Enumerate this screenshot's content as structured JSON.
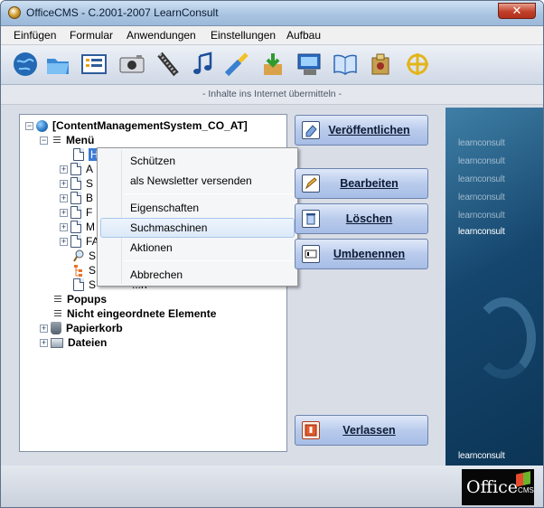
{
  "window": {
    "title": "OfficeCMS - C.2001-2007 LearnConsult",
    "close_label": "✕"
  },
  "menubar": [
    "Einfügen",
    "Formular",
    "Anwendungen",
    "Einstellungen",
    "Aufbau"
  ],
  "toolbar": {
    "icons": [
      "globe-icon",
      "folder-icon",
      "form-list-icon",
      "camera-icon",
      "film-icon",
      "music-note-icon",
      "brush-icon",
      "download-box-icon",
      "projector-icon",
      "book-icon",
      "puzzle-icon",
      "target-icon"
    ]
  },
  "status_text": "- Inhalte ins Internet übermitteln -",
  "tree": {
    "root": "[ContentManagementSystem_CO_AT]",
    "menu": "Menü",
    "children_hidden": [
      "H",
      "A",
      "S",
      "B",
      "F",
      "M",
      "FA",
      "S",
      "S",
      "S"
    ],
    "popups": "Popups",
    "unassigned": "Nicht eingeordnete Elemente",
    "trash": "Papierkorb",
    "files": "Dateien",
    "partial_suffix": "...n"
  },
  "context_menu": {
    "items": [
      "Schützen",
      "als Newsletter versenden",
      "Eigenschaften",
      "Suchmaschinen",
      "Aktionen",
      "Abbrechen"
    ]
  },
  "buttons": {
    "publish": "Veröffentlichen",
    "edit": "Bearbeiten",
    "delete": "Löschen",
    "rename": "Umbenennen",
    "exit": "Verlassen"
  },
  "brand": {
    "logo_text": "learnconsult",
    "office_logo": "Office",
    "office_logo_suffix": "CMS"
  },
  "colors": {
    "accent": "#3d7bd6",
    "brand_panel": "#15466e",
    "button_blue": "#b9cbec"
  }
}
